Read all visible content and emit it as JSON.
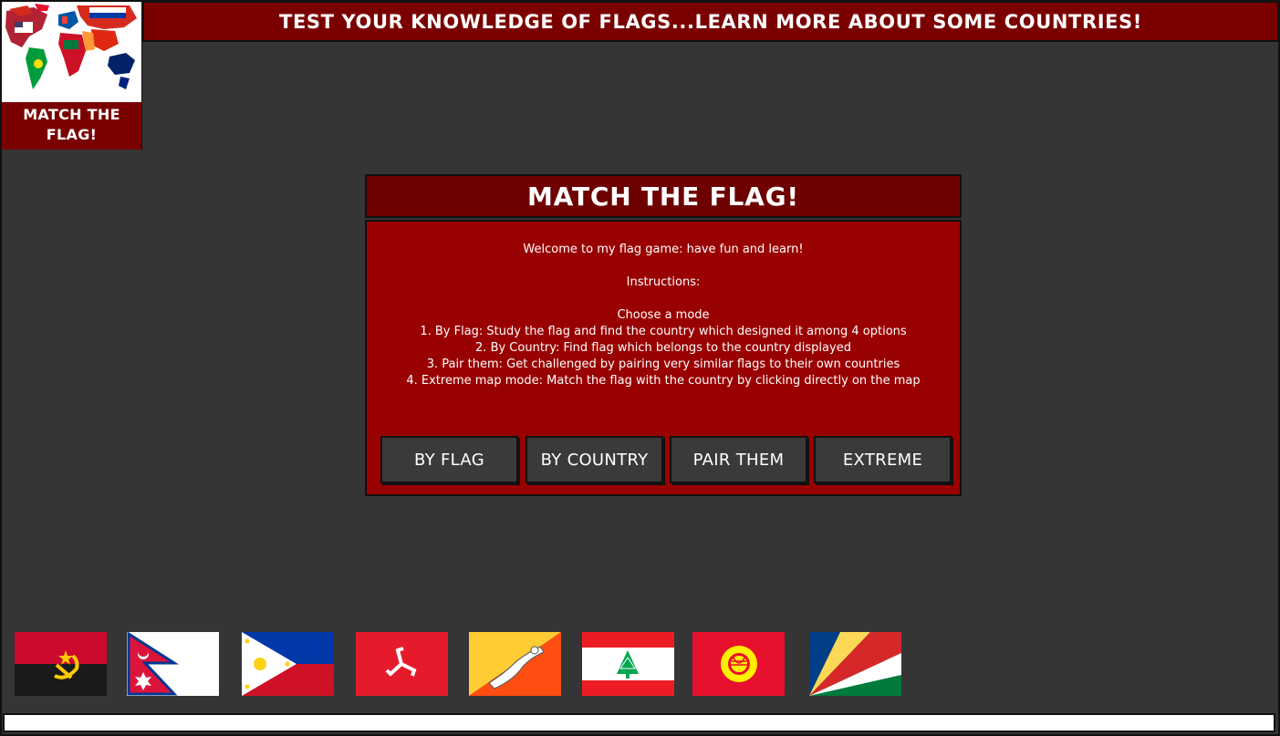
{
  "banner": {
    "text": "TEST YOUR KNOWLEDGE OF FLAGS...LEARN MORE ABOUT SOME COUNTRIES!"
  },
  "logo": {
    "line1": "MATCH THE",
    "line2": "FLAG!"
  },
  "panel": {
    "title": "MATCH THE FLAG!",
    "welcome": "Welcome to my flag game: have fun and learn!",
    "instructions_heading": "Instructions:",
    "choose": "Choose a mode",
    "modes": [
      "1. By Flag: Study the flag and find the country which designed it among 4 options",
      "2. By Country: Find flag which belongs to the country displayed",
      "3. Pair them: Get challenged by pairing very similar flags to their own countries",
      "4. Extreme map mode: Match the flag with the country by clicking directly on the map"
    ]
  },
  "buttons": {
    "by_flag": "BY FLAG",
    "by_country": "BY COUNTRY",
    "pair_them": "PAIR THEM",
    "extreme": "EXTREME"
  },
  "flags": [
    "angola-flag",
    "nepal-flag",
    "philippines-flag",
    "isle-of-man-flag",
    "bhutan-flag",
    "lebanon-flag",
    "kyrgyzstan-flag",
    "seychelles-flag"
  ],
  "colors": {
    "background": "#353535",
    "banner": "#7a0000",
    "panel": "#990000",
    "panel_title": "#6e0000",
    "button": "#3a3a3a"
  }
}
